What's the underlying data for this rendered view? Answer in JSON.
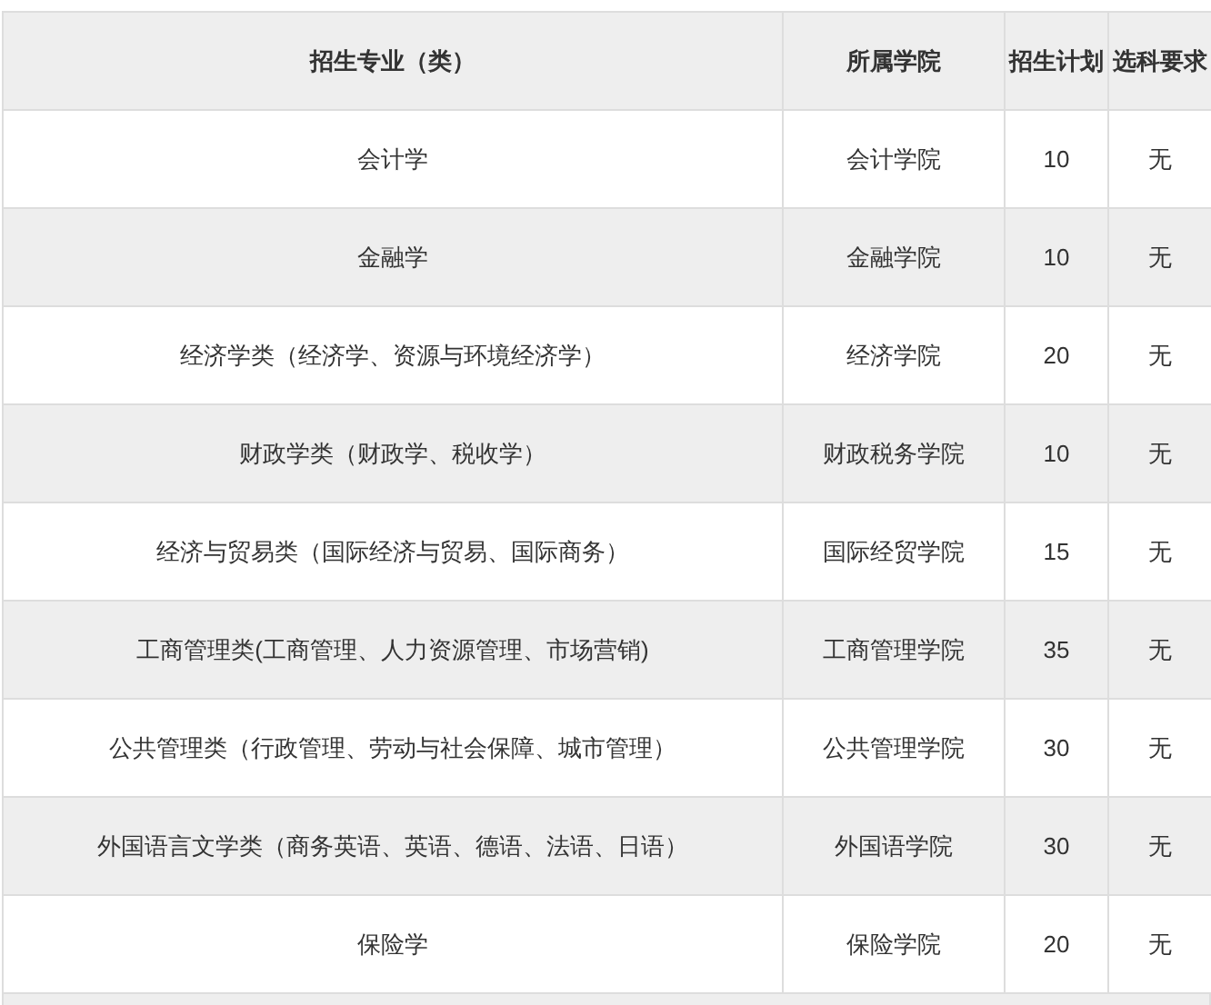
{
  "table": {
    "columns": [
      "招生专业（类）",
      "所属学院",
      "招生计划",
      "选科要求"
    ],
    "rows": [
      [
        "会计学",
        "会计学院",
        "10",
        "无"
      ],
      [
        "金融学",
        "金融学院",
        "10",
        "无"
      ],
      [
        "经济学类（经济学、资源与环境经济学）",
        "经济学院",
        "20",
        "无"
      ],
      [
        "财政学类（财政学、税收学）",
        "财政税务学院",
        "10",
        "无"
      ],
      [
        "经济与贸易类（国际经济与贸易、国际商务）",
        "国际经贸学院",
        "15",
        "无"
      ],
      [
        "工商管理类(工商管理、人力资源管理、市场营销)",
        "工商管理学院",
        "35",
        "无"
      ],
      [
        "公共管理类（行政管理、劳动与社会保障、城市管理）",
        "公共管理学院",
        "30",
        "无"
      ],
      [
        "外国语言文学类（商务英语、英语、德语、法语、日语）",
        "外国语学院",
        "30",
        "无"
      ],
      [
        "保险学",
        "保险学院",
        "20",
        "无"
      ]
    ]
  }
}
